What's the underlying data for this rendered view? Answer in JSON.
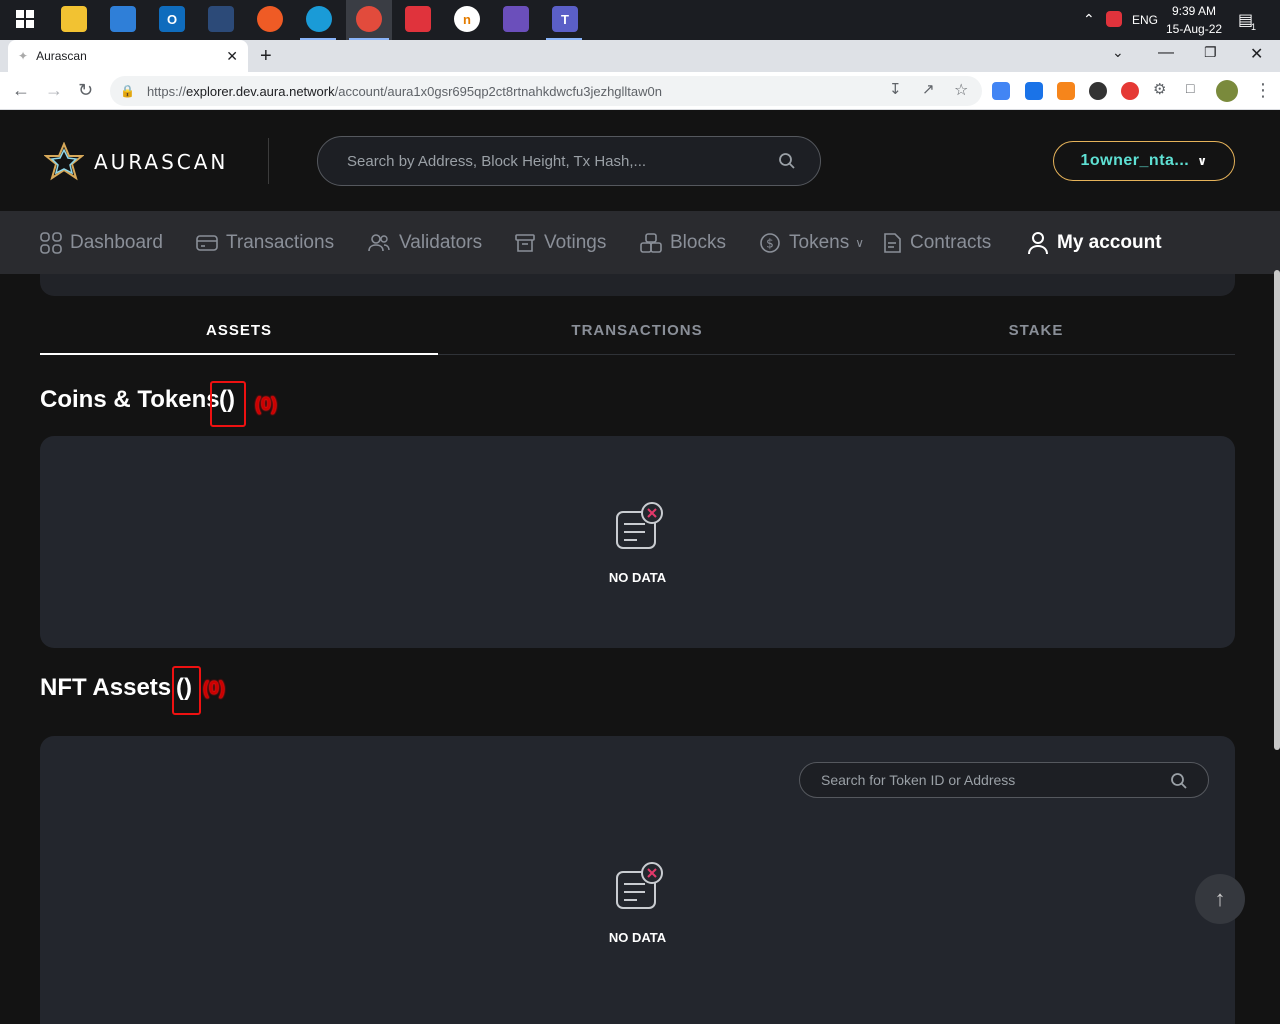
{
  "taskbar": {
    "icons": [
      "windows-start-icon",
      "file-explorer-icon",
      "mail-icon",
      "outlook-icon",
      "ssms-icon",
      "postman-icon",
      "edge-icon",
      "chrome-icon",
      "pocket-icon",
      "unikey-icon",
      "git-icon",
      "teams-icon"
    ],
    "language": "ENG",
    "time": "9:39 AM",
    "date": "15-Aug-22",
    "notification_count": "1"
  },
  "browser": {
    "tab_title": "Aurascan",
    "url_scheme": "https://",
    "url_host": "explorer.dev.aura.network",
    "url_path": "/account/aura1x0gsr695qp2ct8rtnahkdwcfu3jezhglltaw0n"
  },
  "header": {
    "logo_text": "AURASCAN",
    "search_placeholder": "Search by Address, Block Height, Tx Hash,...",
    "account_label": "1owner_nta..."
  },
  "nav": {
    "items": [
      {
        "label": "Dashboard"
      },
      {
        "label": "Transactions"
      },
      {
        "label": "Validators"
      },
      {
        "label": "Votings"
      },
      {
        "label": "Blocks"
      },
      {
        "label": "Tokens"
      },
      {
        "label": "Contracts"
      },
      {
        "label": "My account"
      }
    ]
  },
  "page_tabs": [
    "ASSETS",
    "TRANSACTIONS",
    "STAKE"
  ],
  "coins": {
    "title": "Coins & Tokens",
    "count": "()",
    "annotation": "(0)",
    "empty_text": "NO DATA"
  },
  "nft": {
    "title": "NFT Assets",
    "count": "()",
    "annotation": "(0)",
    "search_placeholder": "Search for Token ID or Address",
    "empty_text": "NO DATA"
  },
  "colors": {
    "accent_teal": "#5ee0d3",
    "accent_gold": "#e6b35a",
    "annotation_red": "#e11111",
    "page_bg": "#131313",
    "panel_bg": "#23262d"
  }
}
